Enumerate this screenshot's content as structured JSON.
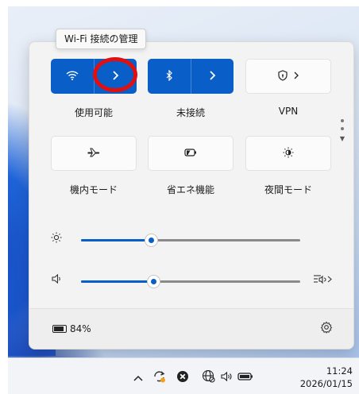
{
  "tooltip": {
    "text": "Wi-Fi 接続の管理"
  },
  "tiles": {
    "wifi": {
      "label": "使用可能",
      "icon": "wifi-icon",
      "state": "on"
    },
    "bluetooth": {
      "label": "未接続",
      "icon": "bluetooth-icon",
      "state": "on"
    },
    "vpn": {
      "label": "VPN",
      "icon": "vpn-shield-icon",
      "state": "off"
    },
    "airplane": {
      "label": "機内モード",
      "icon": "airplane-icon",
      "state": "off"
    },
    "battery_saver": {
      "label": "省エネ機能",
      "icon": "battery-saver-icon",
      "state": "off"
    },
    "night_light": {
      "label": "夜間モード",
      "icon": "night-light-icon",
      "state": "off"
    }
  },
  "sliders": {
    "brightness": {
      "icon": "brightness-icon",
      "level_percent": 32
    },
    "volume": {
      "icon": "speaker-icon",
      "level_percent": 33
    }
  },
  "battery": {
    "percent": "84%"
  },
  "clock": {
    "time": "11:24",
    "date": "2026/01/15"
  },
  "colors": {
    "accent": "#0a5ec8",
    "highlight_circle": "#e01010"
  },
  "glyphs": {
    "chevron": "›",
    "chevron_up": "^"
  }
}
